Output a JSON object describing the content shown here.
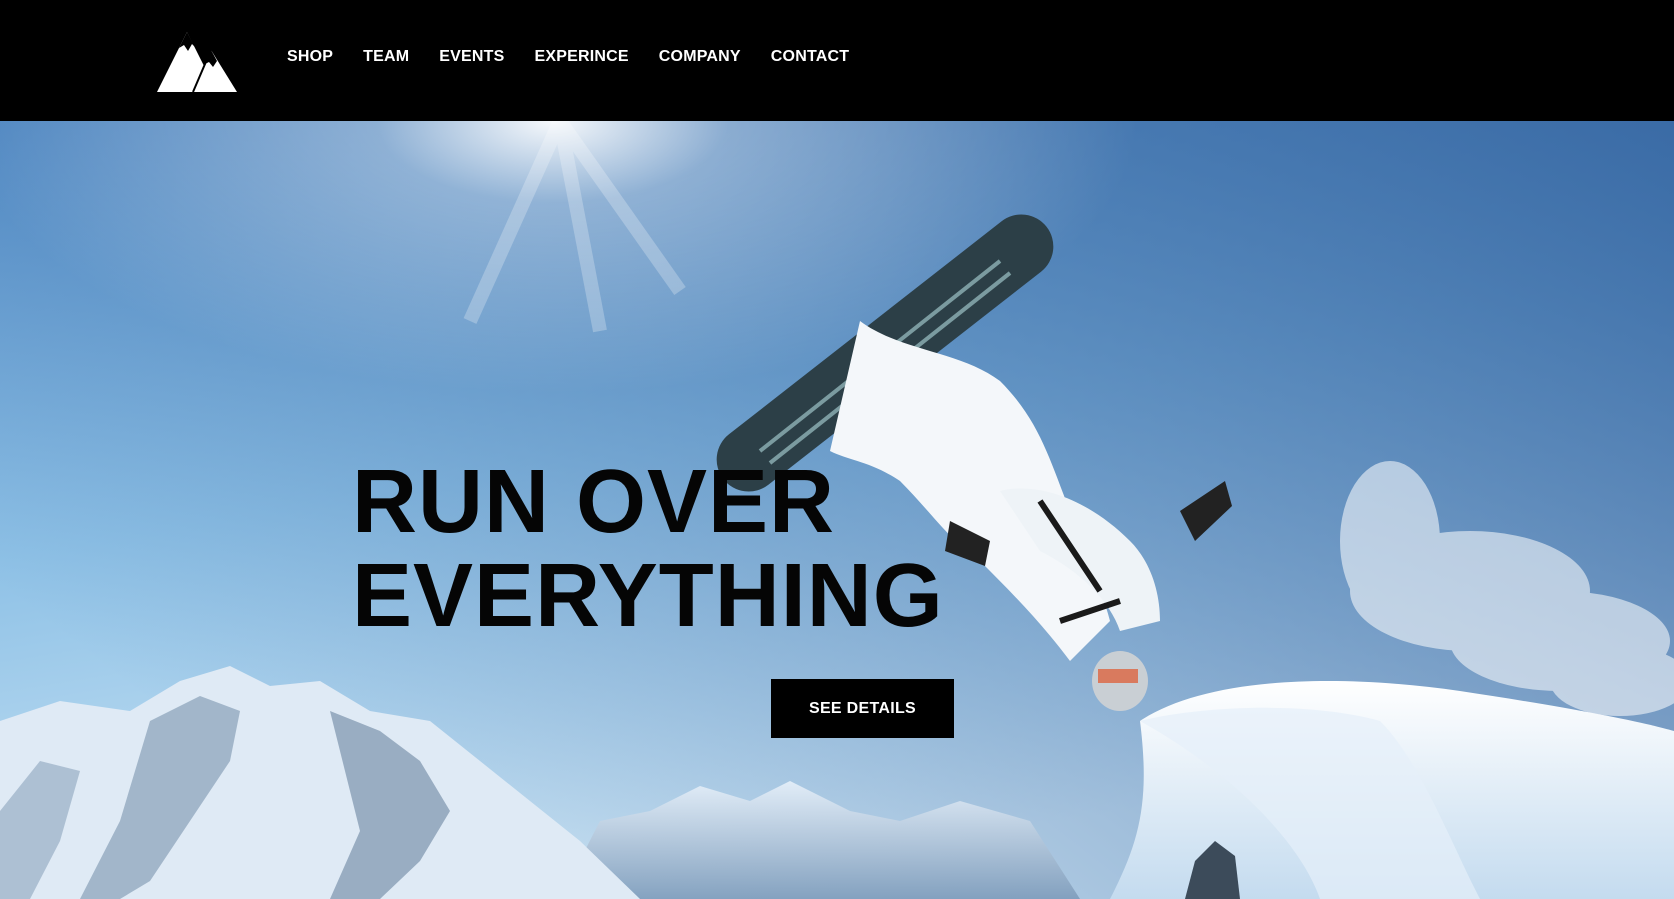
{
  "nav": {
    "items": [
      {
        "label": "SHOP"
      },
      {
        "label": "TEAM"
      },
      {
        "label": "EVENTS"
      },
      {
        "label": "EXPERINCE"
      },
      {
        "label": "COMPANY"
      },
      {
        "label": "CONTACT"
      }
    ]
  },
  "hero": {
    "headline_line1": "RUN OVER",
    "headline_line2": "EVERYTHING",
    "cta_label": "SEE DETAILS"
  },
  "icons": {
    "logo": "mountain-logo-icon"
  },
  "colors": {
    "topbar": "#000000",
    "sky_top": "#3d78b8",
    "sky_bottom": "#cfe6f6",
    "cta_bg": "#000000",
    "cta_text": "#ffffff"
  }
}
